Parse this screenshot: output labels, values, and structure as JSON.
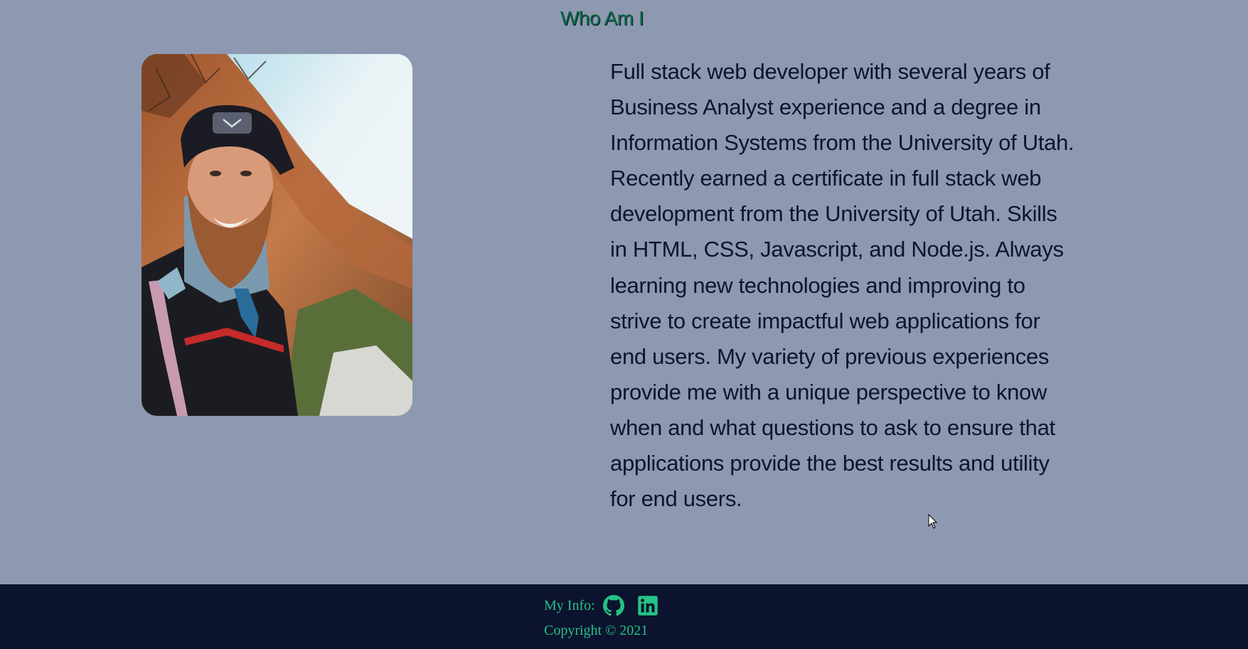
{
  "page": {
    "title": "Who Am I"
  },
  "about": {
    "portrait_alt": "Portrait photo",
    "bio": "Full stack web developer with several years of Business Analyst experience and a degree in Information Systems from the University of Utah. Recently earned a certificate in full stack web development from the University of Utah. Skills in HTML, CSS, Javascript, and Node.js. Always learning new technologies and improving to strive to create impactful web applications for end users. My variety of previous experiences provide me with a unique perspective to know when and what questions to ask to ensure that applications provide the best results and utility for end users."
  },
  "footer": {
    "info_label": "My Info:",
    "copyright": "Copyright © 2021",
    "icons": [
      "github-icon",
      "linkedin-icon"
    ]
  },
  "colors": {
    "background": "#8c99b0",
    "footer_background": "#0c132e",
    "accent": "#25c286",
    "title": "#0b6b43",
    "text": "#0c1530"
  }
}
